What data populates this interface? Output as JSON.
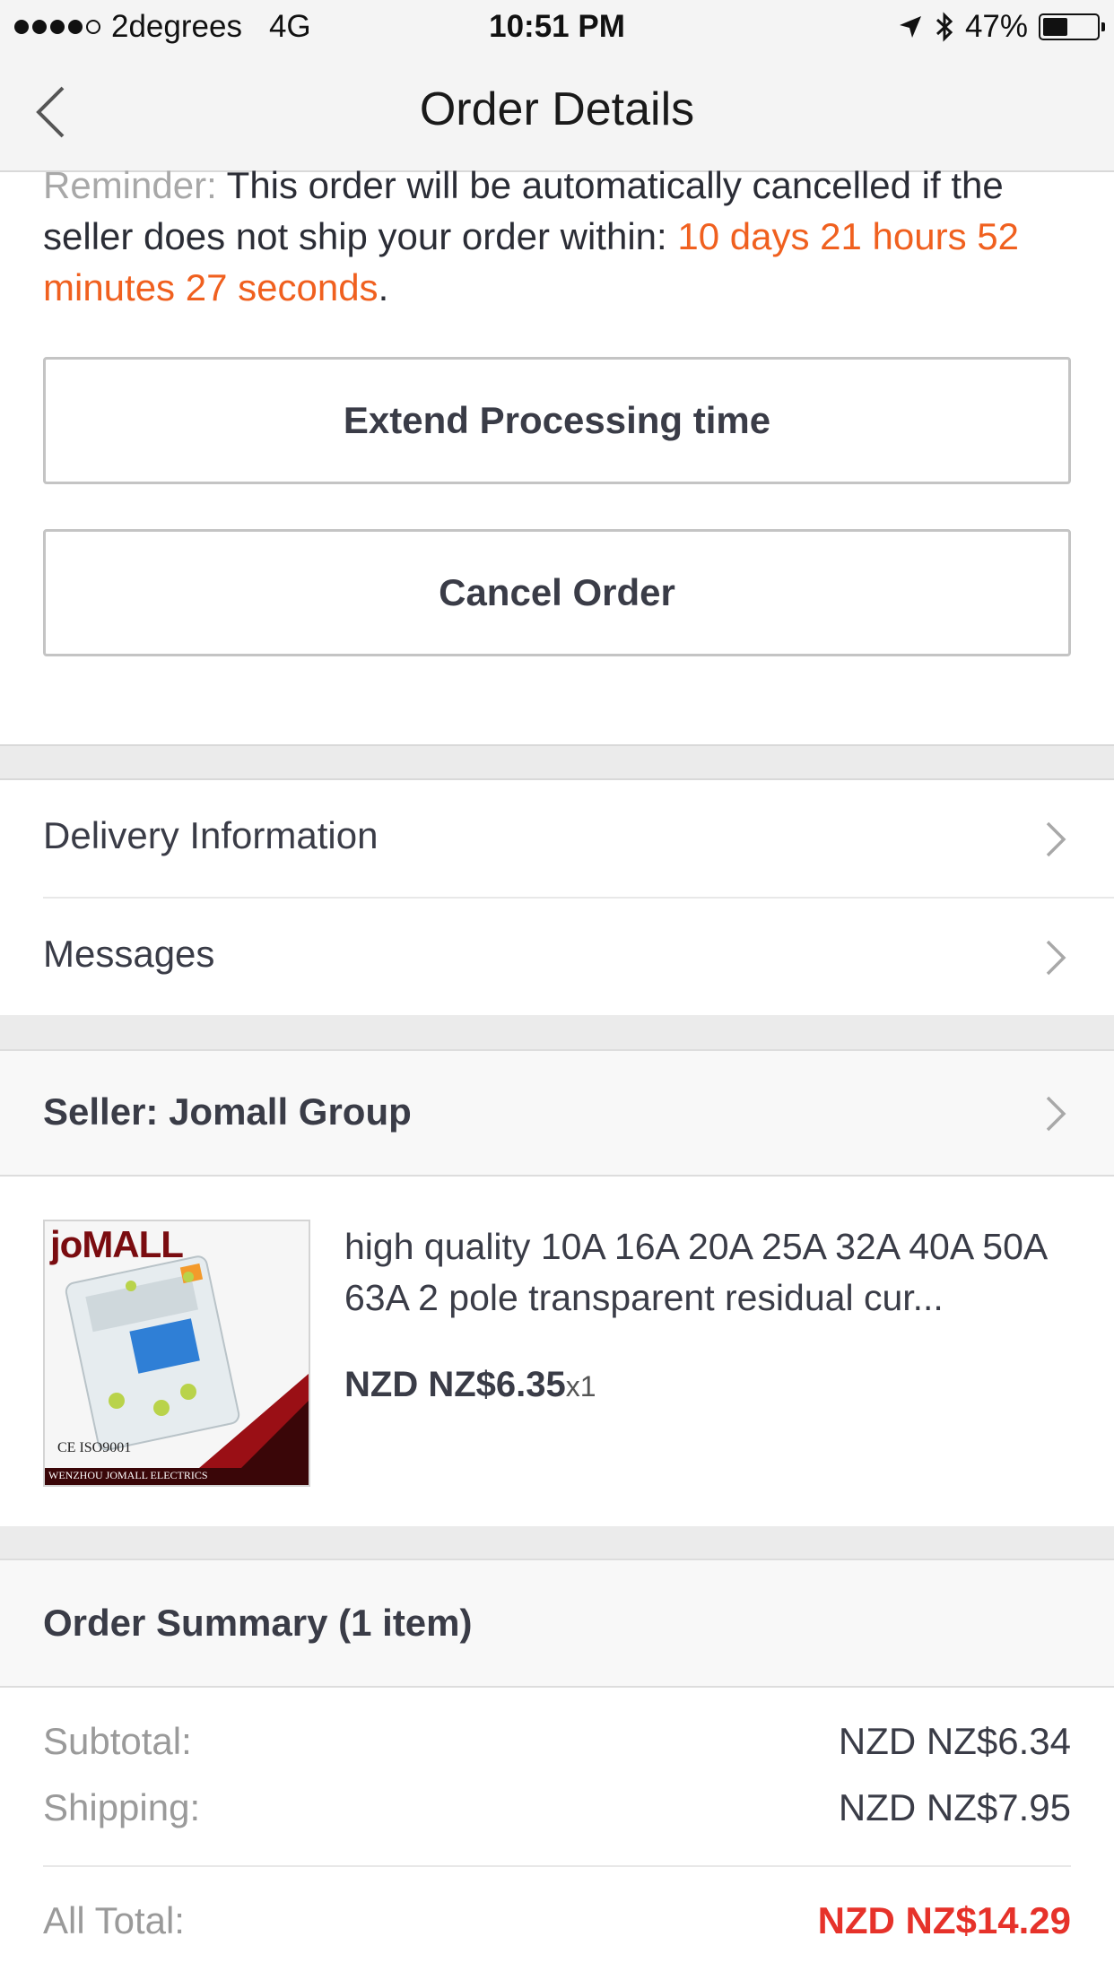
{
  "status_bar": {
    "carrier": "2degrees",
    "network": "4G",
    "time": "10:51 PM",
    "battery": "47%",
    "battery_level": 0.47,
    "signal_bars_filled": 4,
    "signal_bars_total": 5
  },
  "nav": {
    "title": "Order Details",
    "back_icon": "chevron-left-icon"
  },
  "reminder": {
    "label": "Reminder:",
    "text": " This order will be automatically cancelled if the seller does not ship your order within: ",
    "countdown": "10 days 21 hours 52 minutes 27 seconds",
    "end": "."
  },
  "actions": {
    "extend_label": "Extend Processing time",
    "cancel_label": "Cancel Order"
  },
  "menu": {
    "delivery_label": "Delivery Information",
    "messages_label": "Messages"
  },
  "seller": {
    "label": "Seller: Jomall Group"
  },
  "product": {
    "title": "high quality 10A 16A 20A 25A 32A 40A 50A 63A 2 pole transparent residual cur...",
    "price": "NZD NZ$6.35",
    "quantity": "x1",
    "image": {
      "brand": "joMALL",
      "cert": "CE  ISO9001",
      "company": "WENZHOU JOMALL ELECTRICS"
    }
  },
  "summary": {
    "title": "Order Summary (1 item)",
    "subtotal_label": "Subtotal:",
    "subtotal_value": "NZD NZ$6.34",
    "shipping_label": "Shipping:",
    "shipping_value": "NZD NZ$7.95",
    "total_label": "All Total:",
    "total_value": "NZD NZ$14.29"
  },
  "colors": {
    "accent_orange": "#f0601f",
    "total_red": "#e6322a",
    "band_gray": "#ebebeb"
  }
}
